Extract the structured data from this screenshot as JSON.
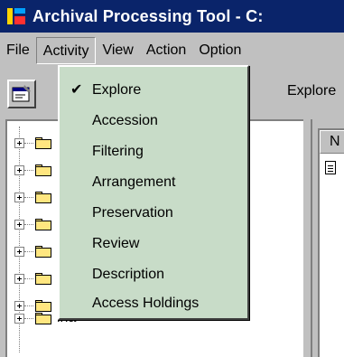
{
  "window": {
    "title": "Archival Processing Tool - C:",
    "icon": "app-icon"
  },
  "menubar": {
    "items": [
      "File",
      "Activity",
      "View",
      "Action",
      "Option"
    ],
    "active": "Activity"
  },
  "toolbar": {
    "properties_icon": "properties-icon",
    "label": "Explore"
  },
  "activity_menu": {
    "items": [
      {
        "label": "Explore",
        "checked": true
      },
      {
        "label": "Accession",
        "checked": false
      },
      {
        "label": "Filtering",
        "checked": false
      },
      {
        "label": "Arrangement",
        "checked": false
      },
      {
        "label": "Preservation",
        "checked": false
      },
      {
        "label": "Review",
        "checked": false
      },
      {
        "label": "Description",
        "checked": false
      },
      {
        "label": "Access Holdings",
        "checked": false
      }
    ],
    "check_glyph": "✔",
    "background_color": "#c8dcc8"
  },
  "tree": {
    "visible_label": "lha"
  },
  "list": {
    "column_header": "N"
  },
  "colors": {
    "titlebar": "#0a246a",
    "chrome": "#c0c0c0"
  }
}
